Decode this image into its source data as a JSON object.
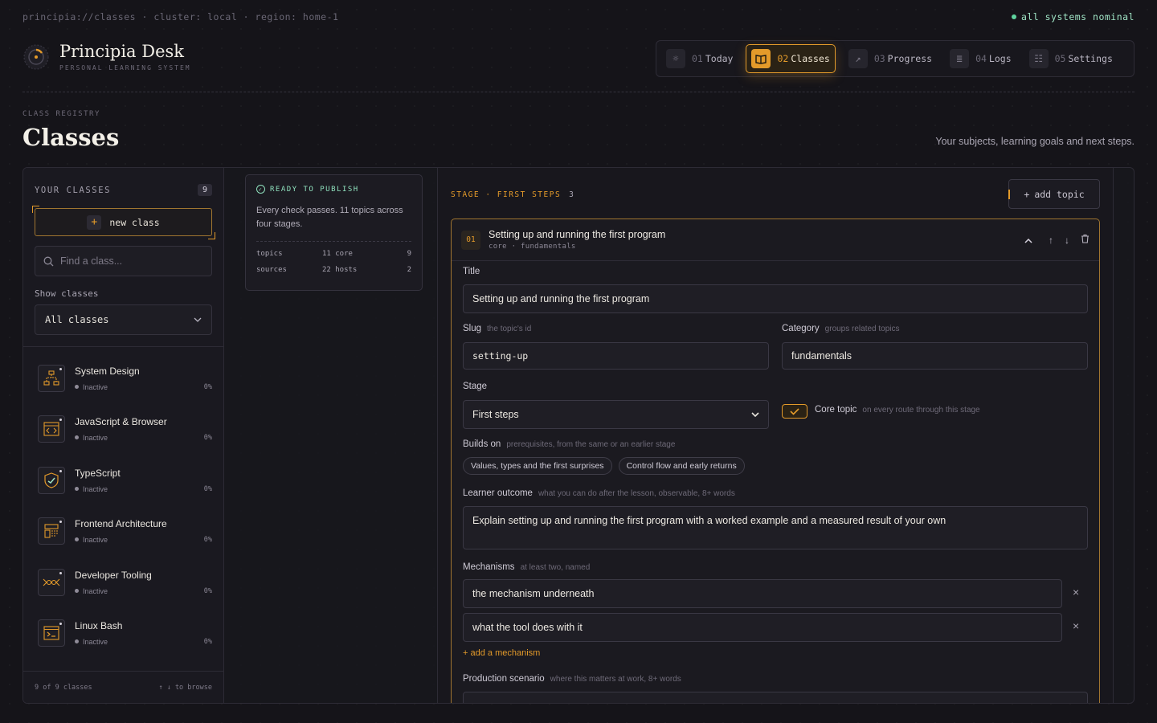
{
  "system": {
    "path": "principia://classes · cluster: local · region: home-1",
    "status": "all systems nominal"
  },
  "brand": {
    "title": "Principia Desk",
    "subtitle": "PERSONAL LEARNING SYSTEM"
  },
  "nav": [
    {
      "num": "01",
      "label": "Today",
      "icon": "sun-icon"
    },
    {
      "num": "02",
      "label": "Classes",
      "icon": "book-icon"
    },
    {
      "num": "03",
      "label": "Progress",
      "icon": "trend-icon"
    },
    {
      "num": "04",
      "label": "Logs",
      "icon": "log-icon"
    },
    {
      "num": "05",
      "label": "Settings",
      "icon": "sliders-icon"
    }
  ],
  "page": {
    "eyebrow": "CLASS REGISTRY",
    "title": "Classes",
    "subtitle": "Your subjects, learning goals and next steps."
  },
  "sidebar": {
    "label": "YOUR CLASSES",
    "count": "9",
    "new_label": "new class",
    "search_placeholder": "Find a class...",
    "show_label": "Show classes",
    "show_value": "All classes",
    "classes": [
      {
        "name": "System Design",
        "status": "Inactive",
        "pct": "0%",
        "icon": "diagram-icon"
      },
      {
        "name": "JavaScript & Browser",
        "status": "Inactive",
        "pct": "0%",
        "icon": "code-window-icon"
      },
      {
        "name": "TypeScript",
        "status": "Inactive",
        "pct": "0%",
        "icon": "shield-icon"
      },
      {
        "name": "Frontend Architecture",
        "status": "Inactive",
        "pct": "0%",
        "icon": "layout-icon"
      },
      {
        "name": "Developer Tooling",
        "status": "Inactive",
        "pct": "0%",
        "icon": "pipeline-icon"
      },
      {
        "name": "Linux Bash",
        "status": "Inactive",
        "pct": "0%",
        "icon": "terminal-icon"
      }
    ],
    "footer_count": "9 of 9 classes",
    "footer_hint": "↑ ↓ to browse"
  },
  "publish": {
    "heading": "READY TO PUBLISH",
    "text": "Every check passes. 11 topics across four stages.",
    "rows": [
      {
        "k": "topics",
        "v": "11 core",
        "n": "9"
      },
      {
        "k": "sources",
        "v": "22 hosts",
        "n": "2"
      }
    ]
  },
  "stage": {
    "label": "STAGE · FIRST STEPS",
    "count": "3",
    "add_topic": "add topic"
  },
  "topic": {
    "num": "01",
    "title": "Setting up and running the first program",
    "tags": "core · fundamentals",
    "fields": {
      "title_label": "Title",
      "title_value": "Setting up and running the first program",
      "slug_label": "Slug",
      "slug_hint": "the topic's id",
      "slug_value": "setting-up",
      "category_label": "Category",
      "category_hint": "groups related topics",
      "category_value": "fundamentals",
      "stage_label": "Stage",
      "stage_value": "First steps",
      "core_label": "Core topic",
      "core_hint": "on every route through this stage",
      "builds_label": "Builds on",
      "builds_hint": "prerequisites, from the same or an earlier stage",
      "builds_chips": [
        "Values, types and the first surprises",
        "Control flow and early returns"
      ],
      "outcome_label": "Learner outcome",
      "outcome_hint": "what you can do after the lesson, observable, 8+ words",
      "outcome_value": "Explain setting up and running the first program with a worked example and a measured result of your own",
      "mech_label": "Mechanisms",
      "mech_hint": "at least two, named",
      "mechanisms": [
        "the mechanism underneath",
        "what the tool does with it"
      ],
      "add_mech": "add a mechanism",
      "scenario_label": "Production scenario",
      "scenario_hint": "where this matters at work, 8+ words"
    }
  }
}
